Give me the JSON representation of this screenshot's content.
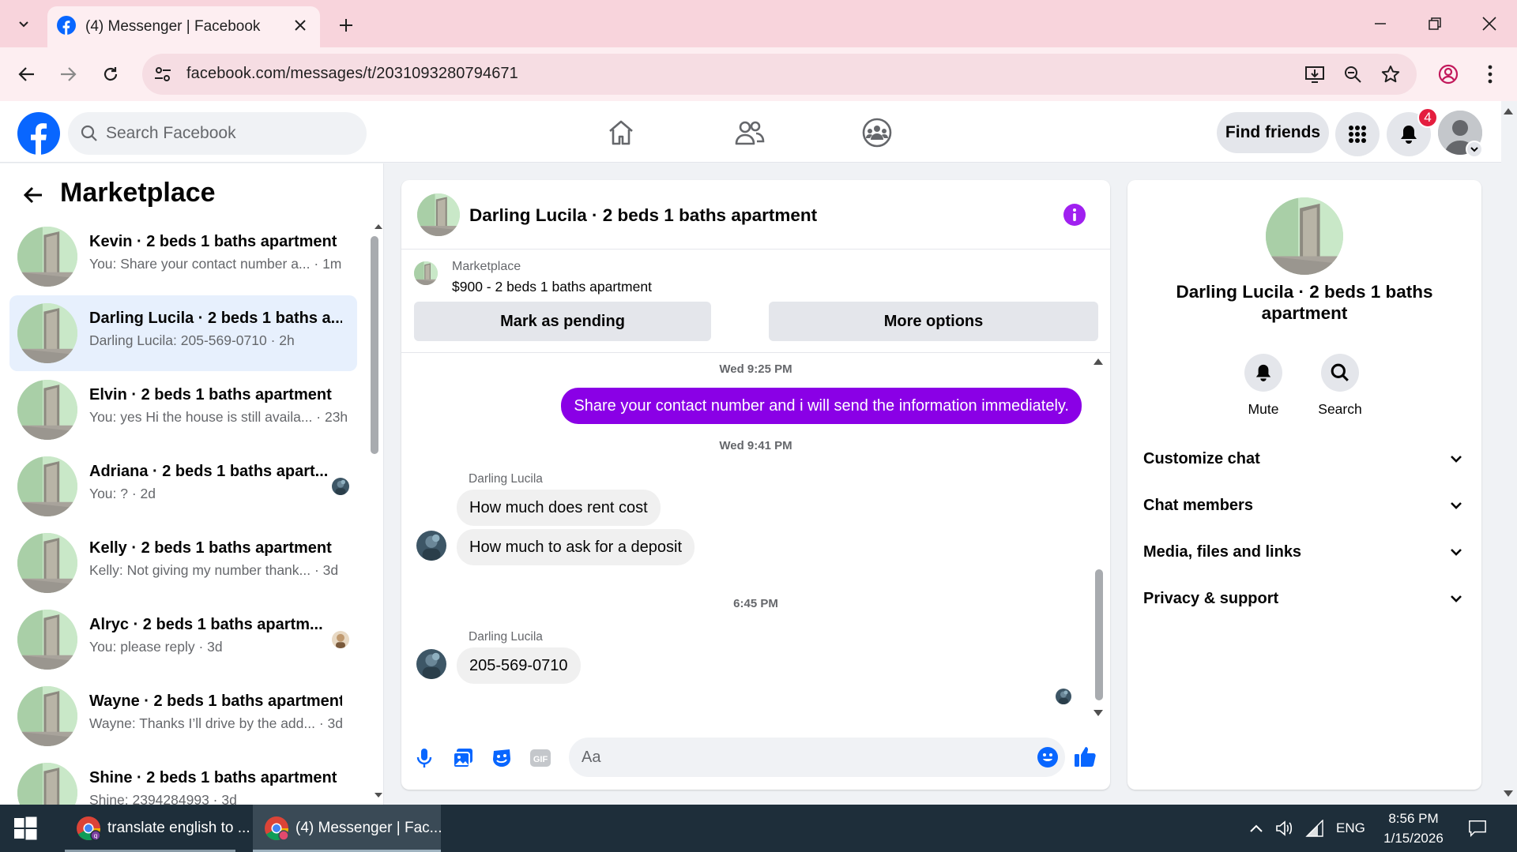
{
  "browser": {
    "tab_title": "(4) Messenger | Facebook",
    "url": "facebook.com/messages/t/2031093280794671"
  },
  "fb": {
    "search_placeholder": "Search Facebook",
    "find_friends_label": "Find friends",
    "notification_count": "4"
  },
  "left_panel": {
    "title": "Marketplace",
    "conversations": [
      {
        "name": "Kevin · 2 beds 1 baths apartment",
        "preview": "You: Share your contact number a... · 1m",
        "active": false
      },
      {
        "name": "Darling Lucila · 2 beds 1 baths a...",
        "preview": "Darling Lucila: 205-569-0710 · 2h",
        "active": true
      },
      {
        "name": "Elvin · 2 beds 1 baths apartment",
        "preview": "You: yes Hi the house is still availa... · 23h",
        "active": false
      },
      {
        "name": "Adriana · 2 beds 1 baths apart...",
        "preview": "You: ? · 2d",
        "active": false
      },
      {
        "name": "Kelly · 2 beds 1 baths apartment",
        "preview": "Kelly: Not giving my number thank... · 3d",
        "active": false
      },
      {
        "name": "Alryc · 2 beds 1 baths apartm...",
        "preview": "You: please reply · 3d",
        "active": false
      },
      {
        "name": "Wayne · 2 beds 1 baths apartment",
        "preview": "Wayne: Thanks I’ll drive by the add... · 3d",
        "active": false
      },
      {
        "name": "Shine · 2 beds 1 baths apartment",
        "preview": "Shine: 2394284993 · 3d",
        "active": false
      }
    ]
  },
  "chat": {
    "title": "Darling Lucila · 2 beds 1 baths apartment",
    "marketplace_label": "Marketplace",
    "listing": "$900 - 2 beds 1 baths apartment",
    "mark_pending_label": "Mark as pending",
    "more_options_label": "More options",
    "timestamp_1": "Wed 9:25 PM",
    "outgoing_1": "Share your contact number and i will send the information immediately.",
    "timestamp_2": "Wed 9:41 PM",
    "sender_1": "Darling Lucila",
    "incoming_1": "How much does rent cost",
    "incoming_2": "How much to ask for a deposit",
    "timestamp_3": "6:45 PM",
    "sender_2": "Darling Lucila",
    "incoming_3": "205-569-0710",
    "composer_placeholder": "Aa"
  },
  "right_panel": {
    "name": "Darling Lucila · 2 beds 1 baths apartment",
    "mute_label": "Mute",
    "search_label": "Search",
    "sections": [
      "Customize chat",
      "Chat members",
      "Media, files and links",
      "Privacy & support"
    ]
  },
  "taskbar": {
    "item_1": "translate english to ...",
    "item_2": "(4) Messenger | Fac...",
    "lang": "ENG",
    "time": "8:56 PM",
    "date": "1/15/2026"
  },
  "colors": {
    "fb_blue": "#0866ff",
    "messenger_purple": "#8a00e6",
    "active_conversation_bg": "#e7f0fd",
    "notification_red": "#e41e3f",
    "tab_strip_pink": "#f8d4dc"
  }
}
